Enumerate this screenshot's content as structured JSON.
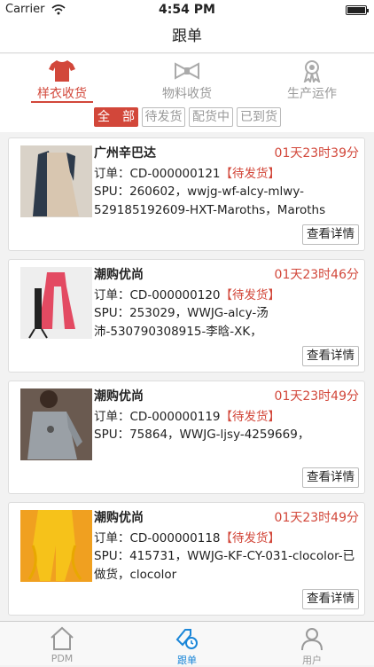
{
  "status_bar": {
    "carrier": "Carrier",
    "time": "4:54 PM"
  },
  "nav": {
    "title": "跟单"
  },
  "category_tabs": [
    {
      "label": "样衣收货",
      "icon": "shirt-icon",
      "active": true
    },
    {
      "label": "物料收货",
      "icon": "bowtie-icon",
      "active": false
    },
    {
      "label": "生产运作",
      "icon": "badge-icon",
      "active": false
    }
  ],
  "filters": [
    {
      "label": "全　部",
      "active": true
    },
    {
      "label": "待发货",
      "active": false
    },
    {
      "label": "配货中",
      "active": false
    },
    {
      "label": "已到货",
      "active": false
    }
  ],
  "orders": [
    {
      "store": "广州辛巴达",
      "timer": "01天23时39分",
      "order_prefix": "订单：CD-000000121",
      "status": "【待发货】",
      "spu": "SPU：260602，wwjg-wf-alcy-mlwy-529185192609-HXT-Maroths，Maroths",
      "detail_label": "查看详情"
    },
    {
      "store": "潮购优尚",
      "timer": "01天23时46分",
      "order_prefix": "订单：CD-000000120",
      "status": "【待发货】",
      "spu": "SPU：253029，WWJG-alcy-汤沛-530790308915-李晗-XK，",
      "detail_label": "查看详情"
    },
    {
      "store": "潮购优尚",
      "timer": "01天23时49分",
      "order_prefix": "订单：CD-000000119",
      "status": "【待发货】",
      "spu": "SPU：75864，WWJG-ljsy-4259669，",
      "detail_label": "查看详情"
    },
    {
      "store": "潮购优尚",
      "timer": "01天23时49分",
      "order_prefix": "订单：CD-000000118",
      "status": "【待发货】",
      "spu": "SPU：415731，WWJG-KF-CY-031-clocolor-已做货，clocolor",
      "detail_label": "查看详情"
    }
  ],
  "tabbar": [
    {
      "label": "PDM",
      "icon": "home-icon",
      "active": false
    },
    {
      "label": "跟单",
      "icon": "follow-icon",
      "active": true
    },
    {
      "label": "用户",
      "icon": "user-icon",
      "active": false
    }
  ],
  "colors": {
    "accent": "#d2473a",
    "tab_active": "#1a86d8"
  }
}
